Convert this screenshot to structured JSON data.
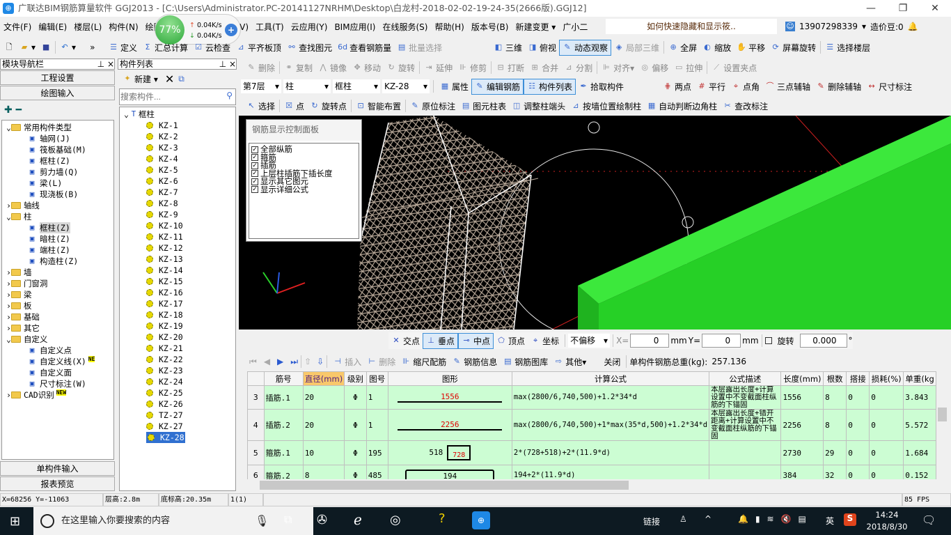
{
  "title": "广联达BIM钢筋算量软件 GGJ2013 - [C:\\Users\\Administrator.PC-20141127NRHM\\Desktop\\白龙村-2018-02-02-19-24-35(2666版).GGJ12]",
  "netmeter": {
    "percent": "77%",
    "up": "0.04K/s",
    "down": "0.04K/s"
  },
  "menu": [
    "文件(F)",
    "编辑(E)",
    "楼层(L)",
    "构件(N)",
    "绘图",
    "(Q)",
    "视图(V)",
    "工具(T)",
    "云应用(Y)",
    "BIM应用(I)",
    "在线服务(S)",
    "帮助(H)",
    "版本号(B)",
    "新建变更 ▾",
    "广小二"
  ],
  "tip": "如何快速隐藏和显示筱..",
  "account": {
    "phone": "13907298339",
    "beans": "造价豆:0"
  },
  "toolbar1": [
    "定义",
    "汇总计算",
    "云检查",
    "平齐板顶",
    "查找图元",
    "查看钢筋量",
    "批量选择"
  ],
  "toolbar1b": [
    "三维",
    "俯视",
    "动态观察",
    "局部三维",
    "全屏",
    "缩放",
    "平移",
    "屏幕旋转",
    "选择楼层"
  ],
  "edit_toolbar": [
    "删除",
    "复制",
    "镜像",
    "移动",
    "旋转",
    "延伸",
    "修剪",
    "打断",
    "合并",
    "分割",
    "对齐▾",
    "偏移",
    "拉伸",
    "设置夹点"
  ],
  "selectors": {
    "floor": "第7层",
    "type": "柱",
    "subtype": "框柱",
    "component": "KZ-28"
  },
  "toolbar3": [
    "属性",
    "编辑钢筋",
    "构件列表",
    "拾取构件"
  ],
  "axis_toolbar": [
    "两点",
    "平行",
    "点角",
    "三点辅轴",
    "删除辅轴",
    "尺寸标注"
  ],
  "toolbar4": [
    "选择",
    "点",
    "旋转点",
    "智能布置",
    "原位标注",
    "图元柱表",
    "调整柱端头",
    "按墙位置绘制柱",
    "自动判断边角柱",
    "查改标注"
  ],
  "nav": {
    "title": "模块导航栏",
    "btn_project": "工程设置",
    "btn_draw": "绘图输入",
    "btn_single": "单构件输入",
    "btn_report": "报表预览",
    "tree": [
      {
        "label": "常用构件类型",
        "level": 0,
        "kind": "folder",
        "open": true
      },
      {
        "label": "轴网(J)",
        "level": 1,
        "icon": "grid-icon"
      },
      {
        "label": "筏板基础(M)",
        "level": 1,
        "icon": "raft-icon"
      },
      {
        "label": "框柱(Z)",
        "level": 1,
        "icon": "column-icon"
      },
      {
        "label": "剪力墙(Q)",
        "level": 1,
        "icon": "wall-icon"
      },
      {
        "label": "梁(L)",
        "level": 1,
        "icon": "beam-icon"
      },
      {
        "label": "现浇板(B)",
        "level": 1,
        "icon": "slab-icon"
      },
      {
        "label": "轴线",
        "level": 0,
        "kind": "folder"
      },
      {
        "label": "柱",
        "level": 0,
        "kind": "folder",
        "open": true
      },
      {
        "label": "框柱(Z)",
        "level": 1,
        "icon": "column-icon",
        "selected": true
      },
      {
        "label": "暗柱(Z)",
        "level": 1,
        "icon": "column-icon"
      },
      {
        "label": "端柱(Z)",
        "level": 1,
        "icon": "column-icon"
      },
      {
        "label": "构造柱(Z)",
        "level": 1,
        "icon": "constructional-column-icon"
      },
      {
        "label": "墙",
        "level": 0,
        "kind": "folder"
      },
      {
        "label": "门窗洞",
        "level": 0,
        "kind": "folder"
      },
      {
        "label": "梁",
        "level": 0,
        "kind": "folder"
      },
      {
        "label": "板",
        "level": 0,
        "kind": "folder"
      },
      {
        "label": "基础",
        "level": 0,
        "kind": "folder"
      },
      {
        "label": "其它",
        "level": 0,
        "kind": "folder"
      },
      {
        "label": "自定义",
        "level": 0,
        "kind": "folder",
        "open": true
      },
      {
        "label": "自定义点",
        "level": 1,
        "icon": "custom-point-icon"
      },
      {
        "label": "自定义线(X)",
        "level": 1,
        "icon": "custom-line-icon",
        "badge": "NE"
      },
      {
        "label": "自定义面",
        "level": 1,
        "icon": "custom-face-icon"
      },
      {
        "label": "尺寸标注(W)",
        "level": 1,
        "icon": "dimension-icon"
      },
      {
        "label": "CAD识别",
        "level": 0,
        "kind": "folder",
        "badge": "NEW"
      }
    ]
  },
  "complist": {
    "title": "构件列表",
    "new_label": "新建 ▾",
    "search_placeholder": "搜索构件...",
    "root": "框柱",
    "items": [
      "KZ-1",
      "KZ-2",
      "KZ-3",
      "KZ-4",
      "KZ-5",
      "KZ-6",
      "KZ-7",
      "KZ-8",
      "KZ-9",
      "KZ-10",
      "KZ-11",
      "KZ-12",
      "KZ-13",
      "KZ-14",
      "KZ-15",
      "KZ-16",
      "KZ-17",
      "KZ-18",
      "KZ-19",
      "KZ-20",
      "KZ-21",
      "KZ-22",
      "KZ-23",
      "KZ-24",
      "KZ-25",
      "KZ-26",
      "TZ-27",
      "KZ-27",
      "KZ-28"
    ],
    "selected": "KZ-28"
  },
  "control_panel": {
    "title": "钢筋显示控制面板",
    "options": [
      "全部纵筋",
      "箍筋",
      "插筋",
      "上层柱插筋下插长度",
      "显示其它图元",
      "显示详细公式"
    ]
  },
  "snap": {
    "items": [
      "交点",
      "垂点",
      "中点",
      "顶点",
      "坐标"
    ],
    "offset": "不偏移",
    "x_label": "X=",
    "x": "0",
    "y_label": "Y=",
    "y": "0",
    "unit": "mm",
    "rotate_label": "旋转",
    "rotate": "0.000",
    "deg": "°"
  },
  "rebar_toolbar": {
    "items": [
      "插入",
      "删除",
      "缩尺配筋",
      "钢筋信息",
      "钢筋图库",
      "其他▾",
      "关闭"
    ],
    "total_label": "单构件钢筋总重(kg):",
    "total": "257.136"
  },
  "table": {
    "headers": [
      "",
      "筋号",
      "直径(mm)",
      "级别",
      "图号",
      "图形",
      "计算公式",
      "公式描述",
      "长度(mm)",
      "根数",
      "搭接",
      "损耗(%)",
      "单重(kg"
    ],
    "rows": [
      {
        "n": "3",
        "name": "插筋.1",
        "dia": "20",
        "grade": "Φ",
        "fig": "1",
        "shape": "1556",
        "formula": "max(2800/6,740,500)+1.2*34*d",
        "desc": "本层露出长度+计算设置中不变截面柱纵筋的下锚固",
        "len": "1556",
        "count": "8",
        "lap": "0",
        "loss": "0",
        "weight": "3.843"
      },
      {
        "n": "4",
        "name": "插筋.2",
        "dia": "20",
        "grade": "Φ",
        "fig": "1",
        "shape": "2256",
        "formula": "max(2800/6,740,500)+1*max(35*d,500)+1.2*34*d",
        "desc": "本层露出长度+错开距离+计算设置中不变截面柱纵筋的下锚固",
        "len": "2256",
        "count": "8",
        "lap": "0",
        "loss": "0",
        "weight": "5.572"
      },
      {
        "n": "5",
        "name": "箍筋.1",
        "dia": "10",
        "grade": "Φ",
        "fig": "195",
        "shape_w": "518",
        "shape": "728",
        "formula": "2*(728+518)+2*(11.9*d)",
        "desc": "",
        "len": "2730",
        "count": "29",
        "lap": "0",
        "loss": "0",
        "weight": "1.684"
      },
      {
        "n": "6",
        "name": "箍筋.2",
        "dia": "8",
        "grade": "Φ",
        "fig": "485",
        "shape": "194",
        "formula": "194+2*(11.9*d)",
        "desc": "",
        "len": "384",
        "count": "32",
        "lap": "0",
        "loss": "0",
        "weight": "0.152"
      }
    ]
  },
  "status": {
    "coords": "X=68256 Y=-11063",
    "floor_h": "层高:2.8m",
    "base_h": "底标高:20.35m",
    "count": "1(1)",
    "fps": "85 FPS"
  },
  "taskbar": {
    "search": "在这里输入你要搜索的内容",
    "link": "链接",
    "ime": "英",
    "time": "14:24",
    "date": "2018/8/30"
  },
  "colors": {
    "viewport_bg": "#000000",
    "beam_green": "#22dd22",
    "table_row": "#ccfdd3",
    "header_highlight": "#f9c86b"
  }
}
